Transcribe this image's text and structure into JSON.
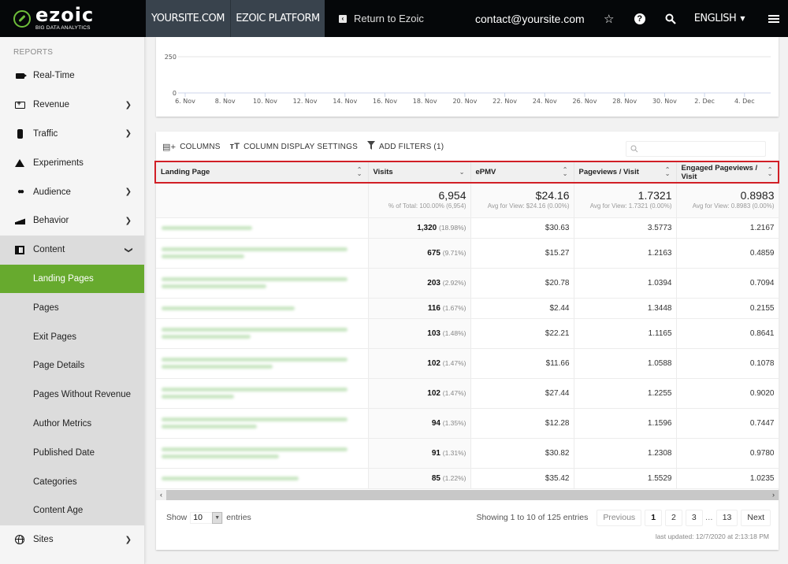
{
  "topbar": {
    "logo_word": "ezoic",
    "logo_sub": "BIG DATA ANALYTICS",
    "tabs": [
      "YOURSITE.COM",
      "EZOIC PLATFORM"
    ],
    "return_label": "Return to Ezoic",
    "email": "contact@yoursite.com",
    "language": "ENGLISH",
    "icons": [
      "star-icon",
      "help-icon",
      "search-icon",
      "menu-list-icon"
    ]
  },
  "sidebar": {
    "heading": "REPORTS",
    "items": [
      {
        "label": "Real-Time",
        "icon": "video-camera-icon",
        "has_chevron": false
      },
      {
        "label": "Revenue",
        "icon": "money-icon",
        "has_chevron": true
      },
      {
        "label": "Traffic",
        "icon": "traffic-light-icon",
        "has_chevron": true
      },
      {
        "label": "Experiments",
        "icon": "flask-icon",
        "has_chevron": false
      },
      {
        "label": "Audience",
        "icon": "users-icon",
        "has_chevron": true
      },
      {
        "label": "Behavior",
        "icon": "area-chart-icon",
        "has_chevron": true
      },
      {
        "label": "Content",
        "icon": "board-icon",
        "has_chevron": true,
        "expanded": true
      }
    ],
    "content_subitems": [
      "Landing Pages",
      "Pages",
      "Exit Pages",
      "Page Details",
      "Pages Without Revenue",
      "Author Metrics",
      "Published Date",
      "Categories",
      "Content Age"
    ],
    "active_subitem": "Landing Pages",
    "after_items": [
      {
        "label": "Sites",
        "icon": "globe-icon",
        "has_chevron": true
      }
    ]
  },
  "chart_data": {
    "type": "line",
    "title": "",
    "xlabel": "",
    "ylabel": "",
    "y_ticks": [
      "0",
      "250"
    ],
    "x_ticks": [
      "6. Nov",
      "8. Nov",
      "10. Nov",
      "12. Nov",
      "14. Nov",
      "16. Nov",
      "18. Nov",
      "20. Nov",
      "22. Nov",
      "24. Nov",
      "26. Nov",
      "28. Nov",
      "30. Nov",
      "2. Dec",
      "4. Dec"
    ],
    "ylim": [
      0,
      250
    ],
    "grid": true,
    "series": []
  },
  "toolbar": {
    "columns_label": "COLUMNS",
    "display_settings_label": "COLUMN DISPLAY SETTINGS",
    "filters_label": "ADD FILTERS (1)",
    "search_placeholder": ""
  },
  "table": {
    "headers": [
      "Landing Page",
      "Visits",
      "ePMV",
      "Pageviews / Visit",
      "Engaged Pageviews / Visit"
    ],
    "totals": {
      "visits": "6,954",
      "visits_sub": "% of Total: 100.00% (6,954)",
      "epmv": "$24.16",
      "epmv_sub": "Avg for View: $24.16 (0.00%)",
      "ppv": "1.7321",
      "ppv_sub": "Avg for View: 1.7321 (0.00%)",
      "eppv": "0.8983",
      "eppv_sub": "Avg for View: 0.8983 (0.00%)"
    },
    "rows": [
      {
        "landing_page": "[blurred URL]",
        "lines": 1,
        "visits": "1,320",
        "pct": "(18.98%)",
        "epmv": "$30.63",
        "ppv": "3.5773",
        "eppv": "1.2167"
      },
      {
        "landing_page": "[blurred URL]",
        "lines": 2,
        "visits": "675",
        "pct": "(9.71%)",
        "epmv": "$15.27",
        "ppv": "1.2163",
        "eppv": "0.4859"
      },
      {
        "landing_page": "[blurred URL]",
        "lines": 2,
        "visits": "203",
        "pct": "(2.92%)",
        "epmv": "$20.78",
        "ppv": "1.0394",
        "eppv": "0.7094"
      },
      {
        "landing_page": "[blurred URL]",
        "lines": 1,
        "visits": "116",
        "pct": "(1.67%)",
        "epmv": "$2.44",
        "ppv": "1.3448",
        "eppv": "0.2155"
      },
      {
        "landing_page": "[blurred URL]",
        "lines": 2,
        "visits": "103",
        "pct": "(1.48%)",
        "epmv": "$22.21",
        "ppv": "1.1165",
        "eppv": "0.8641"
      },
      {
        "landing_page": "[blurred URL]",
        "lines": 2,
        "visits": "102",
        "pct": "(1.47%)",
        "epmv": "$11.66",
        "ppv": "1.0588",
        "eppv": "0.1078"
      },
      {
        "landing_page": "[blurred URL]",
        "lines": 2,
        "visits": "102",
        "pct": "(1.47%)",
        "epmv": "$27.44",
        "ppv": "1.2255",
        "eppv": "0.9020"
      },
      {
        "landing_page": "[blurred URL]",
        "lines": 2,
        "visits": "94",
        "pct": "(1.35%)",
        "epmv": "$12.28",
        "ppv": "1.1596",
        "eppv": "0.7447"
      },
      {
        "landing_page": "[blurred URL]",
        "lines": 2,
        "visits": "91",
        "pct": "(1.31%)",
        "epmv": "$30.82",
        "ppv": "1.2308",
        "eppv": "0.9780"
      },
      {
        "landing_page": "[blurred URL]",
        "lines": 1,
        "visits": "85",
        "pct": "(1.22%)",
        "epmv": "$35.42",
        "ppv": "1.5529",
        "eppv": "1.0235"
      }
    ]
  },
  "footer": {
    "show_label": "Show",
    "page_length": "10",
    "entries_label": "entries",
    "info": "Showing 1 to 10 of 125 entries",
    "pagination": {
      "previous": "Previous",
      "pages": [
        "1",
        "2",
        "3"
      ],
      "ellipsis": "…",
      "last_page": "13",
      "next": "Next",
      "current": "1"
    },
    "last_updated": "last updated: 12/7/2020 at 2:13:18 PM"
  },
  "colors": {
    "topbar_bg": "#050709",
    "tab_bg": "#39434d",
    "brand_green": "#6fbf3a",
    "active_item": "#67aa2e",
    "header_outline": "#d11f26"
  }
}
